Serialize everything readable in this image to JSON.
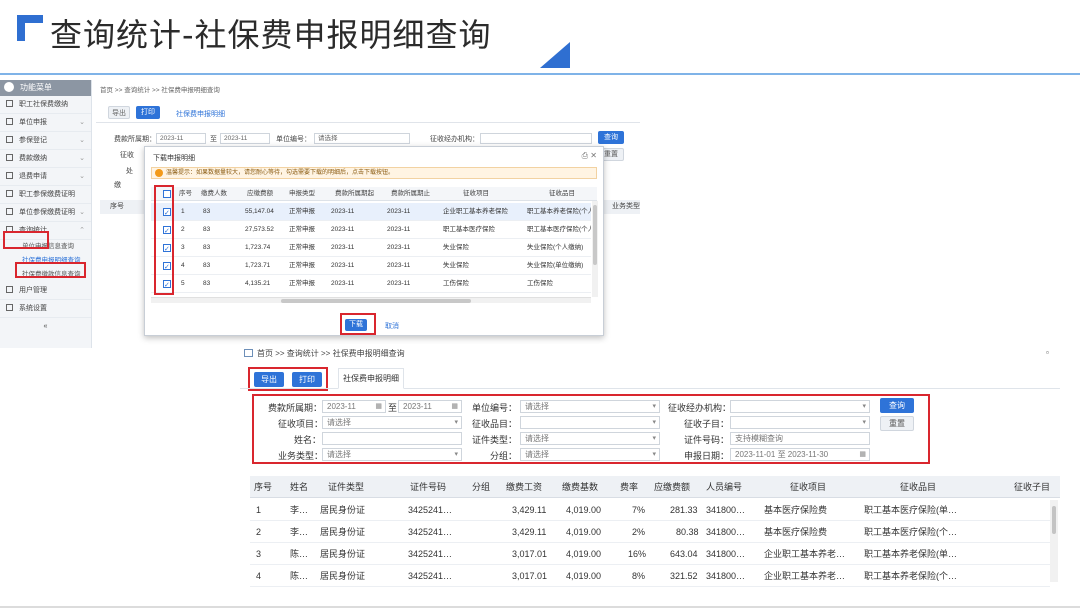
{
  "slide": {
    "title": "查询统计-社保费申报明细查询"
  },
  "upper": {
    "sidebar": {
      "header": "功能菜单",
      "items": [
        {
          "label": "职工社保费缴纳"
        },
        {
          "label": "单位申报"
        },
        {
          "label": "参保登记"
        },
        {
          "label": "费款缴纳"
        },
        {
          "label": "退费申请"
        },
        {
          "label": "职工参保缴费证明"
        },
        {
          "label": "单位参保缴费证明"
        },
        {
          "label": "查询统计"
        }
      ],
      "sub_items": [
        {
          "label": "单位申报信息查询"
        },
        {
          "label": "社保费申报明细查询"
        },
        {
          "label": "社保费缴款信息查询"
        }
      ],
      "more_items": [
        {
          "label": "用户管理"
        },
        {
          "label": "系统设置"
        }
      ],
      "collapse": "«"
    },
    "breadcrumb": "首页 >> 查询统计 >> 社保费申报明细查询",
    "buttons": {
      "export": "导出",
      "print": "打印"
    },
    "tab": "社保费申报明细",
    "filters": {
      "period_label": "费款所属期：",
      "period_from": "2023-11",
      "period_to": "2023-11",
      "to": "至",
      "unit_label": "单位编号：",
      "unit_value": "请选择",
      "agency_label": "征收经办机构："
    },
    "query_button": "查询",
    "reset_button": "重置",
    "row_label_1": "征收",
    "row_label_2": "处",
    "row_label_3": "缴",
    "table_head_seq": "序号",
    "table_head_last": "业务类型"
  },
  "dialog": {
    "title": "下载申报明细",
    "tools": "⎙  ✕",
    "tip": "温馨提示：如果数据量较大，请您耐心等待，勾选需要下载的明细后，点击下载按钮。",
    "columns": [
      "序号",
      "缴费人数",
      "应缴费额",
      "申报类型",
      "费款所属期起",
      "费款所属期止",
      "征收项目",
      "征收品目"
    ],
    "rows": [
      {
        "seq": "1",
        "count": "83",
        "amount": "55,147.04",
        "type": "正常申报",
        "from": "2023-11",
        "to": "2023-11",
        "item": "企业职工基本养老保险",
        "sub": "职工基本养老保险(个人缴纳)"
      },
      {
        "seq": "2",
        "count": "83",
        "amount": "27,573.52",
        "type": "正常申报",
        "from": "2023-11",
        "to": "2023-11",
        "item": "职工基本医疗保险",
        "sub": "职工基本医疗保险(个人缴纳)"
      },
      {
        "seq": "3",
        "count": "83",
        "amount": "1,723.74",
        "type": "正常申报",
        "from": "2023-11",
        "to": "2023-11",
        "item": "失业保险",
        "sub": "失业保险(个人缴纳)"
      },
      {
        "seq": "4",
        "count": "83",
        "amount": "1,723.71",
        "type": "正常申报",
        "from": "2023-11",
        "to": "2023-11",
        "item": "失业保险",
        "sub": "失业保险(单位缴纳)"
      },
      {
        "seq": "5",
        "count": "83",
        "amount": "4,135.21",
        "type": "正常申报",
        "from": "2023-11",
        "to": "2023-11",
        "item": "工伤保险",
        "sub": "工伤保险"
      }
    ],
    "download": "下载",
    "cancel": "取消"
  },
  "lower": {
    "breadcrumb": "首页 >> 查询统计 >> 社保费申报明细查询",
    "buttons": {
      "export": "导出",
      "print": "打印"
    },
    "tab": "社保费申报明细",
    "filters": {
      "period_label": "费款所属期：",
      "period_from": "2023-11",
      "to": "至",
      "period_to": "2023-11",
      "unit_label": "单位编号：",
      "unit_value": "请选择",
      "agency_label": "征收经办机构：",
      "item_label": "征收项目：",
      "item_value": "请选择",
      "sub_label": "征收品目：",
      "subitem_label": "征收子目：",
      "name_label": "姓名：",
      "idtype_label": "证件类型：",
      "idtype_value": "请选择",
      "idno_label": "证件号码：",
      "idno_value": "支持模糊查询",
      "biz_label": "业务类型：",
      "biz_value": "请选择",
      "group_label": "分组：",
      "group_value": "请选择",
      "date_label": "申报日期：",
      "date_from": "2023-11-01",
      "date_to": "2023-11-30"
    },
    "query_button": "查询",
    "reset_button": "重置",
    "columns": [
      "序号",
      "姓名",
      "证件类型",
      "证件号码",
      "分组",
      "缴费工资",
      "缴费基数",
      "费率",
      "应缴费额",
      "人员编号",
      "征收项目",
      "征收品目",
      "征收子目"
    ],
    "rows": [
      {
        "seq": "1",
        "name": "李…",
        "idtype": "居民身份证",
        "idno": "3425241…",
        "wage": "3,429.11",
        "base": "4,019.00",
        "rate": "7%",
        "amount": "281.33",
        "pid": "341800…",
        "item": "基本医疗保险费",
        "sub": "职工基本医疗保险(单…"
      },
      {
        "seq": "2",
        "name": "李…",
        "idtype": "居民身份证",
        "idno": "3425241…",
        "wage": "3,429.11",
        "base": "4,019.00",
        "rate": "2%",
        "amount": "80.38",
        "pid": "341800…",
        "item": "基本医疗保险费",
        "sub": "职工基本医疗保险(个…"
      },
      {
        "seq": "3",
        "name": "陈…",
        "idtype": "居民身份证",
        "idno": "3425241…",
        "wage": "3,017.01",
        "base": "4,019.00",
        "rate": "16%",
        "amount": "643.04",
        "pid": "341800…",
        "item": "企业职工基本养老…",
        "sub": "职工基本养老保险(单…"
      },
      {
        "seq": "4",
        "name": "陈…",
        "idtype": "居民身份证",
        "idno": "3425241…",
        "wage": "3,017.01",
        "base": "4,019.00",
        "rate": "8%",
        "amount": "321.52",
        "pid": "341800…",
        "item": "企业职工基本养老…",
        "sub": "职工基本养老保险(个…"
      }
    ]
  },
  "colors": {
    "accent": "#2e73d8",
    "highlight": "#d9262e",
    "title_mark": "#2f6fd1"
  }
}
